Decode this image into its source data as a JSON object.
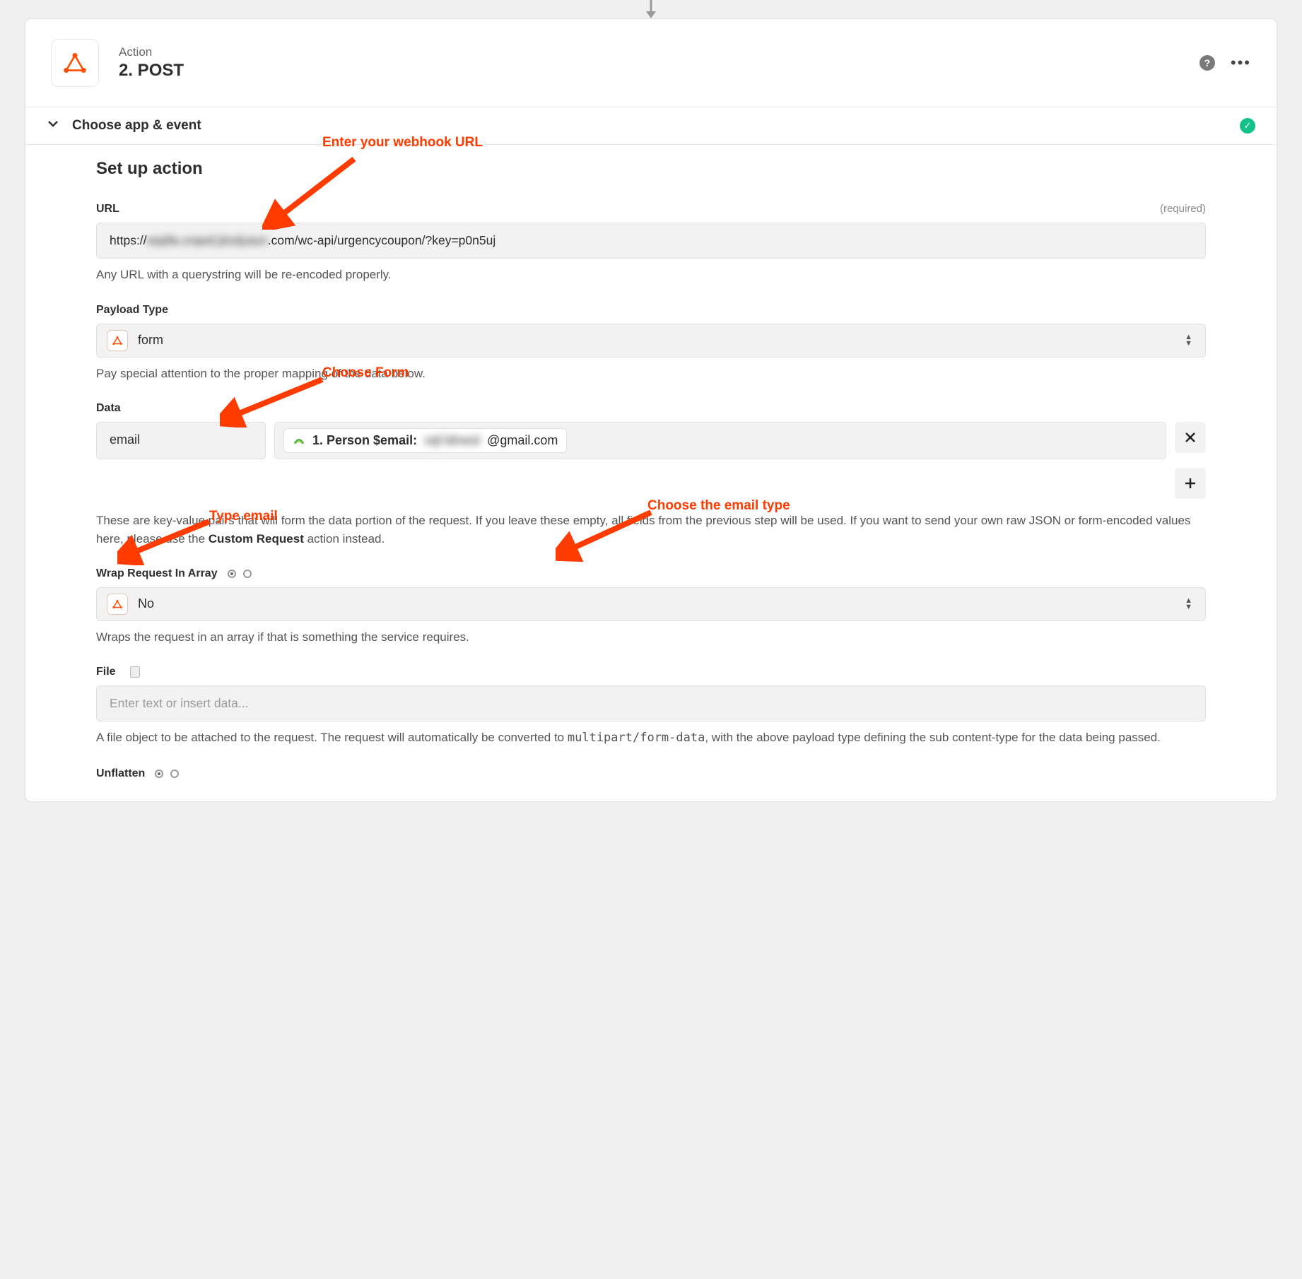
{
  "header": {
    "label": "Action",
    "title": "2. POST"
  },
  "section_choose": {
    "title": "Choose app & event"
  },
  "setup": {
    "title": "Set up action",
    "url": {
      "label": "URL",
      "required": "(required)",
      "value_prefix": "https://",
      "value_blur": "wqdla.xrqwd.jksdyaun",
      "value_suffix": ".com/wc-api/urgencycoupon/?key=p0n5uj",
      "help": "Any URL with a querystring will be re-encoded properly."
    },
    "payload": {
      "label": "Payload Type",
      "value": "form",
      "help": "Pay special attention to the proper mapping of the data below."
    },
    "data": {
      "label": "Data",
      "key": "email",
      "value_prefix": "1. Person $email:",
      "value_blur": "xqf.ldnwsl",
      "value_suffix": "@gmail.com",
      "desc_1": "These are key-value pairs that will form the data portion of the request. If you leave these empty, all fields from the previous step will be used. If you want to send your own raw JSON or form-encoded values here, please use the ",
      "desc_bold": "Custom Request",
      "desc_2": " action instead."
    },
    "wrap": {
      "label": "Wrap Request In Array",
      "value": "No",
      "help": "Wraps the request in an array if that is something the service requires."
    },
    "file": {
      "label": "File",
      "placeholder": "Enter text or insert data...",
      "help_1": "A file object to be attached to the request. The request will automatically be converted to ",
      "help_mono": "multipart/form-data",
      "help_2": ", with the above payload type defining the sub content-type for the data being passed."
    },
    "unflatten": {
      "label": "Unflatten"
    }
  },
  "annotations": {
    "webhook": "Enter your webhook URL",
    "form": "Choose Form",
    "email": "Type email",
    "emailtype": "Choose the email type"
  }
}
